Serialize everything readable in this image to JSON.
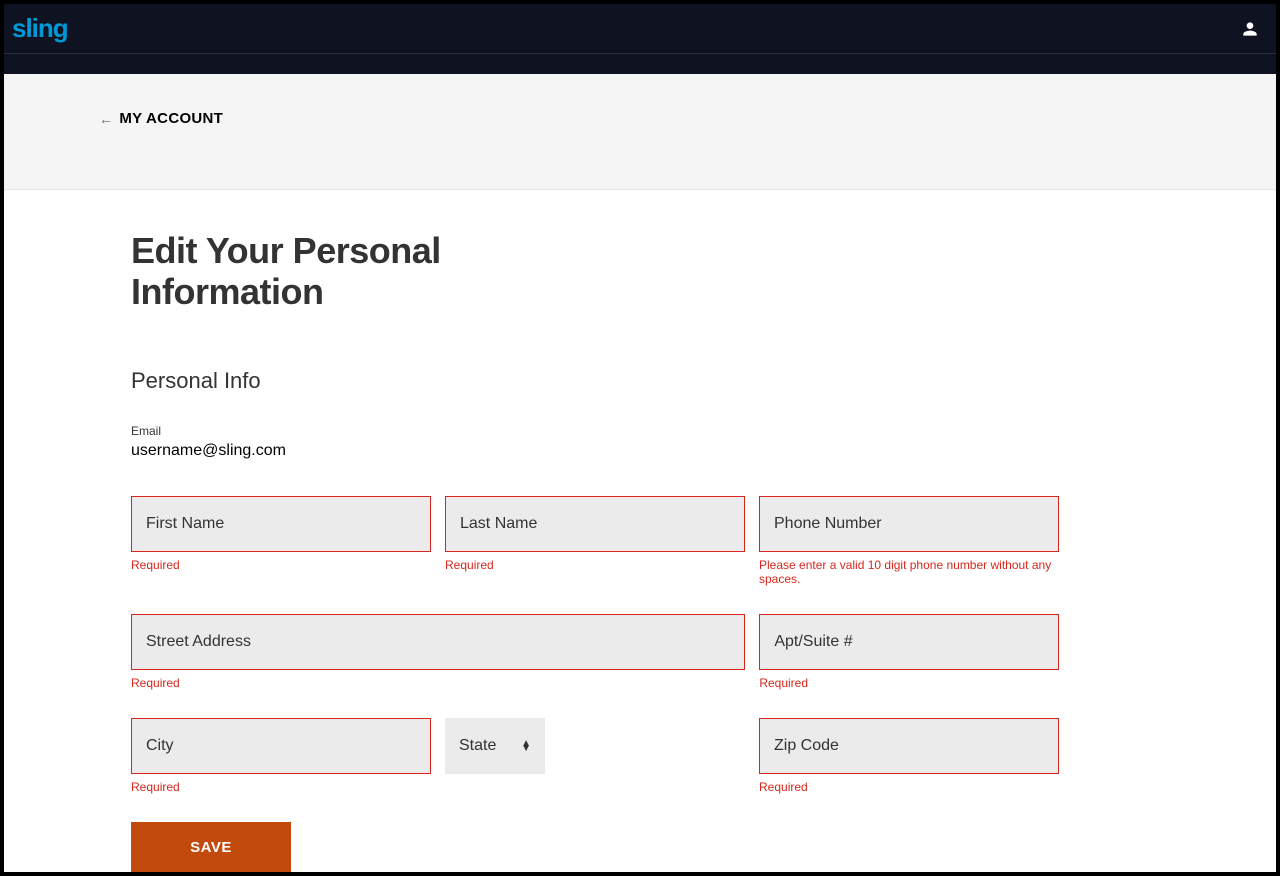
{
  "brand": "sling",
  "breadcrumb": {
    "label": "MY ACCOUNT"
  },
  "page": {
    "title": "Edit Your Personal Information",
    "section": "Personal Info"
  },
  "email": {
    "label": "Email",
    "value": "username@sling.com"
  },
  "form": {
    "firstName": {
      "placeholder": "First Name",
      "error": "Required"
    },
    "lastName": {
      "placeholder": "Last Name",
      "error": "Required"
    },
    "phone": {
      "placeholder": "Phone Number",
      "error": "Please enter a valid 10 digit phone number without any spaces."
    },
    "street": {
      "placeholder": "Street Address",
      "error": "Required"
    },
    "apt": {
      "placeholder": "Apt/Suite #",
      "error": "Required"
    },
    "city": {
      "placeholder": "City",
      "error": "Required"
    },
    "state": {
      "label": "State"
    },
    "zip": {
      "placeholder": "Zip Code",
      "error": "Required"
    }
  },
  "buttons": {
    "save": "SAVE"
  }
}
